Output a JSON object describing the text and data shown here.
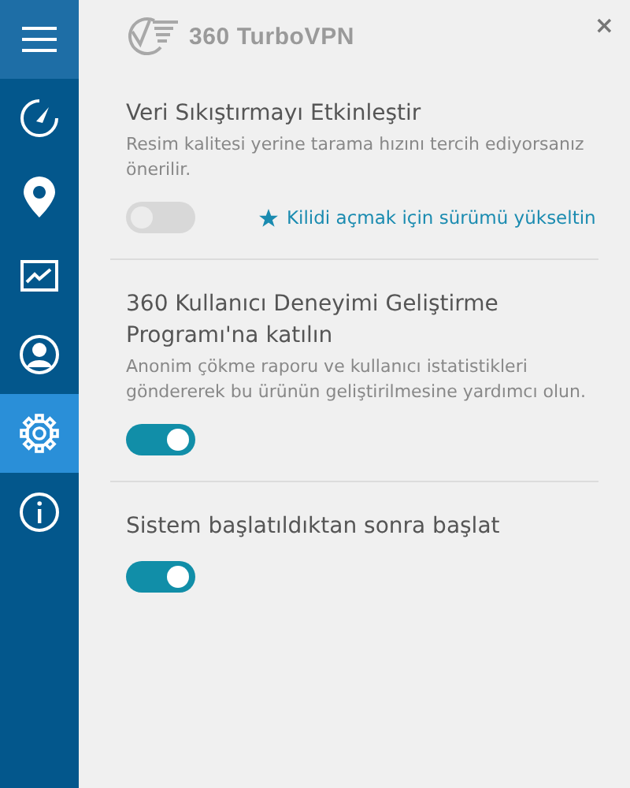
{
  "sidebar": {
    "items": [
      {
        "selected": false
      },
      {
        "selected": false
      },
      {
        "selected": false
      },
      {
        "selected": false
      },
      {
        "selected": false
      },
      {
        "selected": true
      },
      {
        "selected": false
      }
    ]
  },
  "header": {
    "logo_text": "360 TurboVPN",
    "close": "×"
  },
  "settings": [
    {
      "title": "Veri Sıkıştırmayı Etkinleştir",
      "description": "Resim kalitesi yerine tarama hızını tercih ediyorsanız önerilir.",
      "on": false,
      "disabled": true,
      "upgrade_link": "Kilidi açmak için sürümü yükseltin"
    },
    {
      "title": "360 Kullanıcı Deneyimi Geliştirme Programı'na katılın",
      "description": "Anonim çökme raporu ve kullanıcı istatistikleri göndererek bu ürünün geliştirilmesine yardımcı olun.",
      "on": true,
      "disabled": false
    },
    {
      "title": "Sistem başlatıldıktan sonra başlat",
      "on": true,
      "disabled": false
    }
  ]
}
